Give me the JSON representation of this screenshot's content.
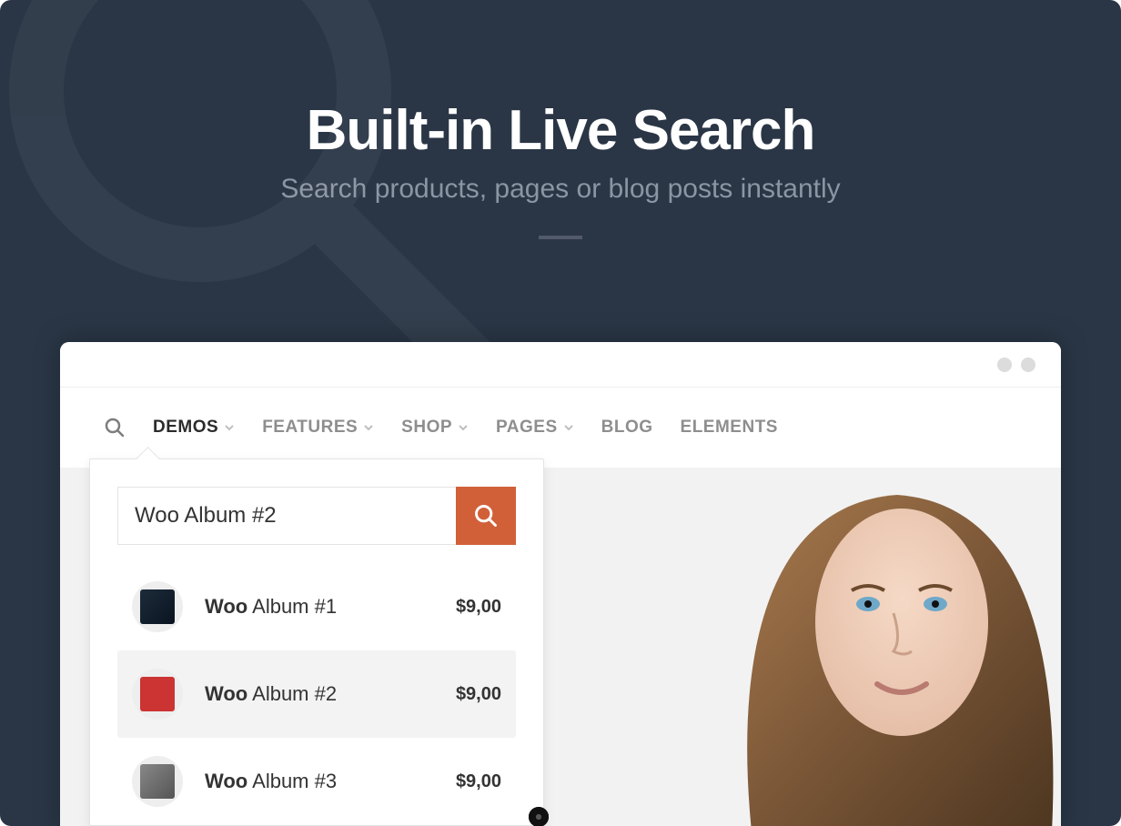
{
  "hero": {
    "title": "Built-in Live Search",
    "subtitle": "Search products, pages or blog posts instantly"
  },
  "nav": {
    "items": [
      {
        "label": "DEMOS",
        "has_chevron": true,
        "active": true
      },
      {
        "label": "FEATURES",
        "has_chevron": true,
        "active": false
      },
      {
        "label": "SHOP",
        "has_chevron": true,
        "active": false
      },
      {
        "label": "PAGES",
        "has_chevron": true,
        "active": false
      },
      {
        "label": "BLOG",
        "has_chevron": false,
        "active": false
      },
      {
        "label": "ELEMENTS",
        "has_chevron": false,
        "active": false
      }
    ]
  },
  "search": {
    "query": "Woo Album #2",
    "results": [
      {
        "match": "Woo",
        "rest": " Album #1",
        "price": "$9,00",
        "highlight": false
      },
      {
        "match": "Woo",
        "rest": " Album #2",
        "price": "$9,00",
        "highlight": true
      },
      {
        "match": "Woo",
        "rest": " Album #3",
        "price": "$9,00",
        "highlight": false
      }
    ]
  }
}
